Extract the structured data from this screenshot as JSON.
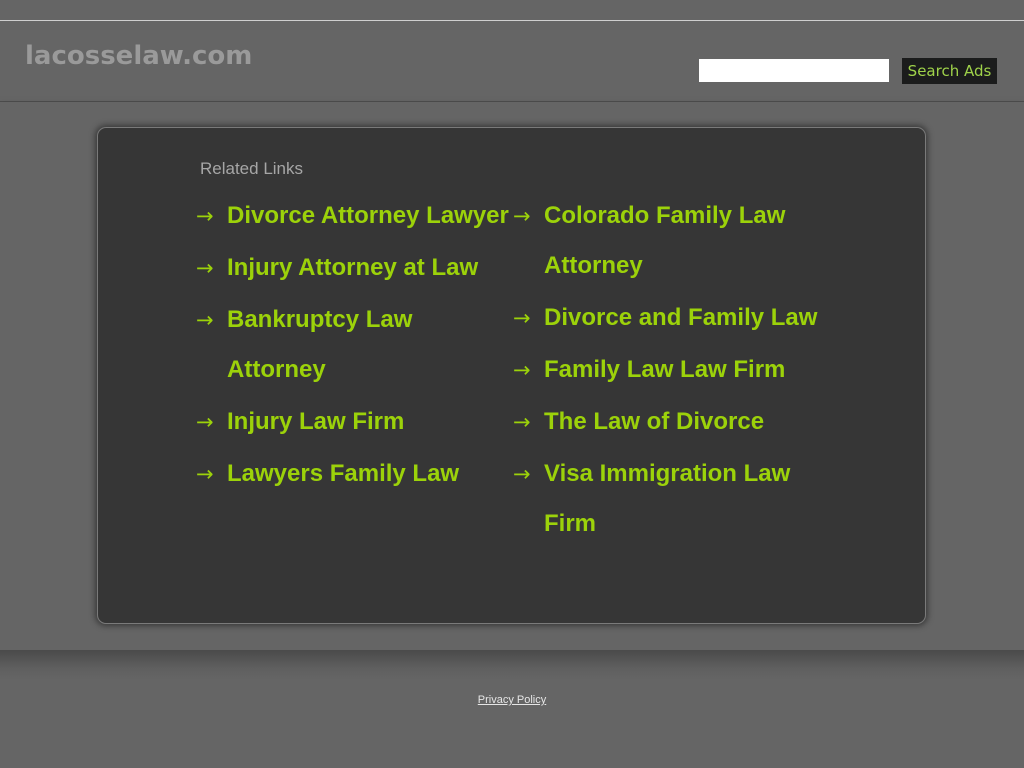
{
  "header": {
    "site_title": "lacosselaw.com",
    "search": {
      "input_value": "",
      "placeholder": "",
      "button_label": "Search Ads"
    }
  },
  "main": {
    "heading": "Related Links",
    "arrow_icon": "→",
    "left_links": [
      {
        "label": "Divorce Attorney Lawyer"
      },
      {
        "label": "Injury Attorney at Law"
      },
      {
        "label": "Bankruptcy Law Attorney"
      },
      {
        "label": "Injury Law Firm"
      },
      {
        "label": "Lawyers Family Law"
      }
    ],
    "right_links": [
      {
        "label": "Colorado Family Law Attorney"
      },
      {
        "label": "Divorce and Family Law"
      },
      {
        "label": "Family Law Law Firm"
      },
      {
        "label": "The Law of Divorce"
      },
      {
        "label": "Visa Immigration Law Firm"
      }
    ]
  },
  "footer": {
    "privacy_label": "Privacy Policy"
  },
  "colors": {
    "link": "#9cd20a",
    "background": "#656565",
    "panel": "#363636",
    "button_bg": "#1b1c1c",
    "button_text": "#9fd34a"
  }
}
